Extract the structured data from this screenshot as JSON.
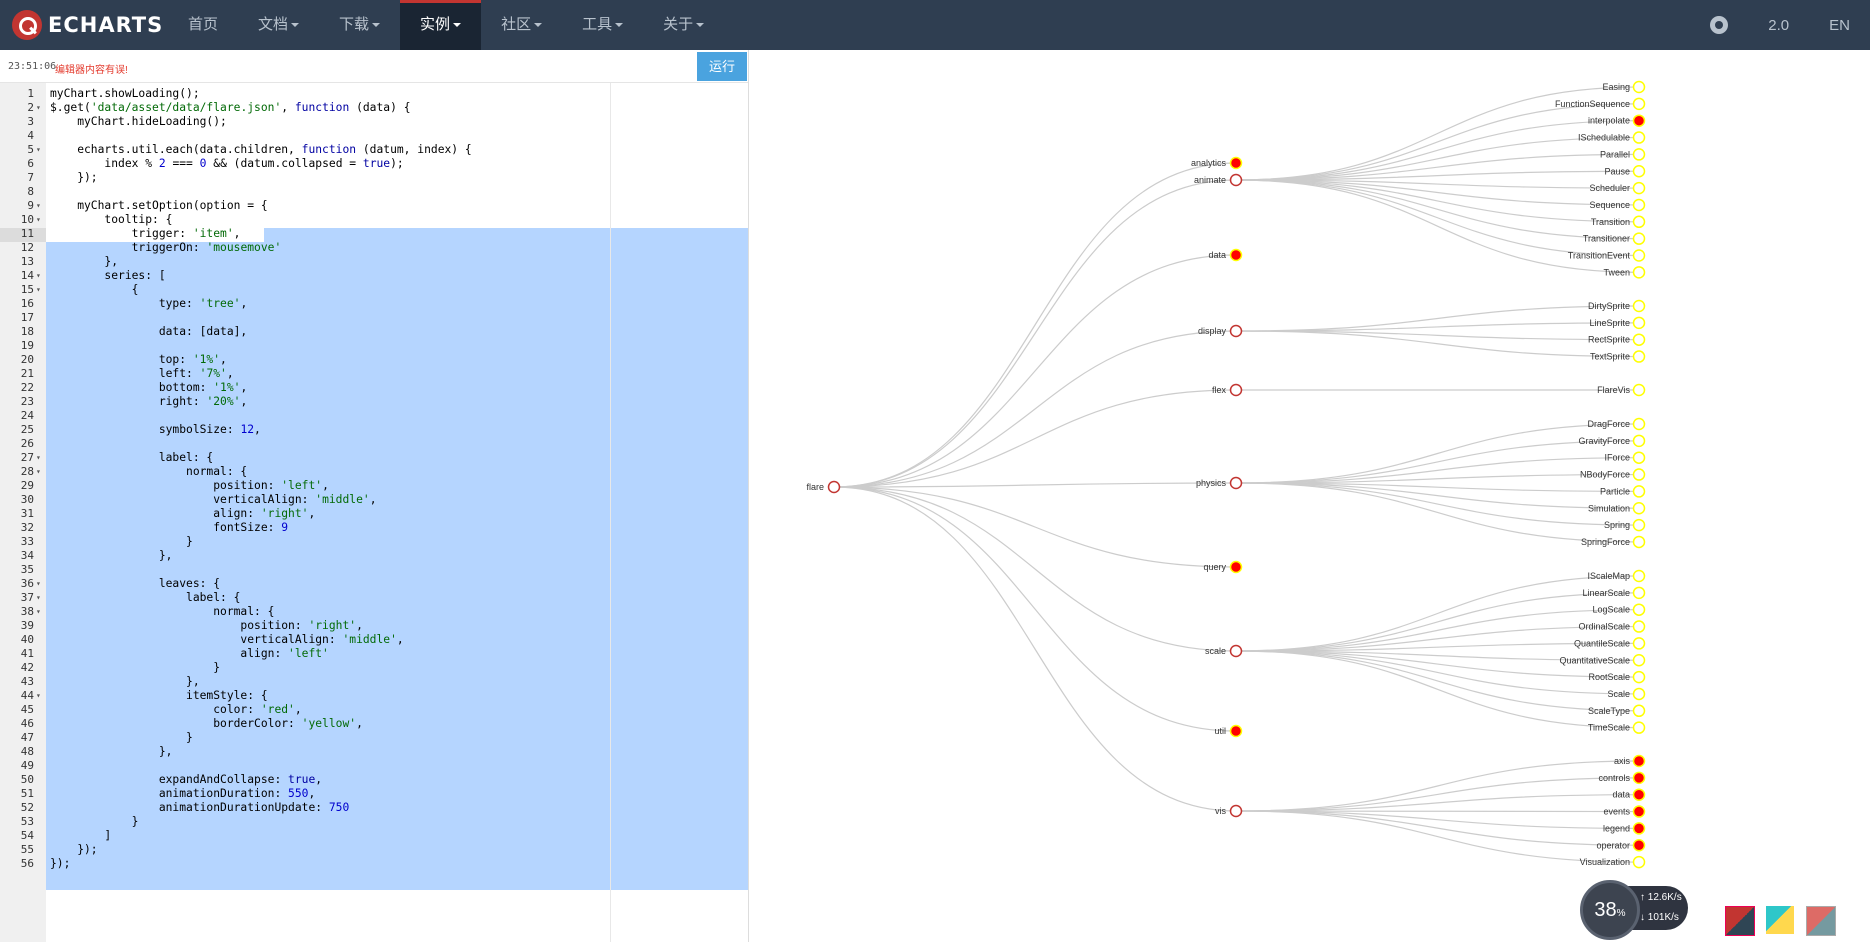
{
  "navbar": {
    "logo": "ECHARTS",
    "items": [
      {
        "label": "首页",
        "dropdown": false,
        "active": false
      },
      {
        "label": "文档",
        "dropdown": true,
        "active": false
      },
      {
        "label": "下载",
        "dropdown": true,
        "active": false
      },
      {
        "label": "实例",
        "dropdown": true,
        "active": true
      },
      {
        "label": "社区",
        "dropdown": true,
        "active": false
      },
      {
        "label": "工具",
        "dropdown": true,
        "active": false
      },
      {
        "label": "关于",
        "dropdown": true,
        "active": false
      }
    ],
    "version": "2.0",
    "lang": "EN",
    "github_icon": "github-icon"
  },
  "editor": {
    "timestamp": "23:51:06",
    "tip": "编辑器内容有误!",
    "run_label": "运行",
    "lines": [
      "myChart.showLoading();",
      "$.get('data/asset/data/flare.json', function (data) {",
      "    myChart.hideLoading();",
      "",
      "    echarts.util.each(data.children, function (datum, index) {",
      "        index % 2 === 0 && (datum.collapsed = true);",
      "    });",
      "",
      "    myChart.setOption(option = {",
      "        tooltip: {",
      "            trigger: 'item',",
      "            triggerOn: 'mousemove'",
      "        },",
      "        series: [",
      "            {",
      "                type: 'tree',",
      "",
      "                data: [data],",
      "",
      "                top: '1%',",
      "                left: '7%',",
      "                bottom: '1%',",
      "                right: '20%',",
      "",
      "                symbolSize: 12,",
      "",
      "                label: {",
      "                    normal: {",
      "                        position: 'left',",
      "                        verticalAlign: 'middle',",
      "                        align: 'right',",
      "                        fontSize: 9",
      "                    }",
      "                },",
      "",
      "                leaves: {",
      "                    label: {",
      "                        normal: {",
      "                            position: 'right',",
      "                            verticalAlign: 'middle',",
      "                            align: 'left'",
      "                        }",
      "                    },",
      "                    itemStyle: {",
      "                        color: 'red',",
      "                        borderColor: 'yellow',",
      "                    }",
      "                },",
      "",
      "                expandAndCollapse: true,",
      "                animationDuration: 550,",
      "                animationDurationUpdate: 750",
      "            }",
      "        ]",
      "    });",
      "});"
    ],
    "fold_lines": [
      2,
      5,
      9,
      10,
      14,
      15,
      27,
      28,
      36,
      37,
      38,
      44
    ]
  },
  "tree": {
    "root": {
      "name": "flare"
    },
    "children": [
      {
        "name": "analytics",
        "collapsed": true
      },
      {
        "name": "animate",
        "collapsed": false,
        "children": [
          "Easing",
          "FunctionSequence",
          "interpolate",
          "ISchedulable",
          "Parallel",
          "Pause",
          "Scheduler",
          "Sequence",
          "Transition",
          "Transitioner",
          "TransitionEvent",
          "Tween"
        ],
        "child_collapsed": [
          "interpolate"
        ]
      },
      {
        "name": "data",
        "collapsed": true
      },
      {
        "name": "display",
        "collapsed": false,
        "children": [
          "DirtySprite",
          "LineSprite",
          "RectSprite",
          "TextSprite"
        ],
        "child_collapsed": []
      },
      {
        "name": "flex",
        "collapsed": false,
        "children": [
          "FlareVis"
        ],
        "child_collapsed": []
      },
      {
        "name": "physics",
        "collapsed": false,
        "children": [
          "DragForce",
          "GravityForce",
          "IForce",
          "NBodyForce",
          "Particle",
          "Simulation",
          "Spring",
          "SpringForce"
        ],
        "child_collapsed": []
      },
      {
        "name": "query",
        "collapsed": true
      },
      {
        "name": "scale",
        "collapsed": false,
        "children": [
          "IScaleMap",
          "LinearScale",
          "LogScale",
          "OrdinalScale",
          "QuantileScale",
          "QuantitativeScale",
          "RootScale",
          "Scale",
          "ScaleType",
          "TimeScale"
        ],
        "child_collapsed": []
      },
      {
        "name": "util",
        "collapsed": true
      },
      {
        "name": "vis",
        "collapsed": false,
        "children": [
          "axis",
          "controls",
          "data",
          "events",
          "legend",
          "operator",
          "Visualization"
        ],
        "child_collapsed": [
          "axis",
          "controls",
          "data",
          "events",
          "legend",
          "operator"
        ]
      }
    ],
    "colors": {
      "root_border": "#c23531",
      "node_fill": "#ffffff",
      "collapsed_fill": "red",
      "leaf_border": "yellow",
      "link": "#ccc"
    }
  },
  "speed_widget": {
    "percent": "38",
    "percent_unit": "%",
    "upload": "12.6K/s",
    "download": "101K/s"
  }
}
